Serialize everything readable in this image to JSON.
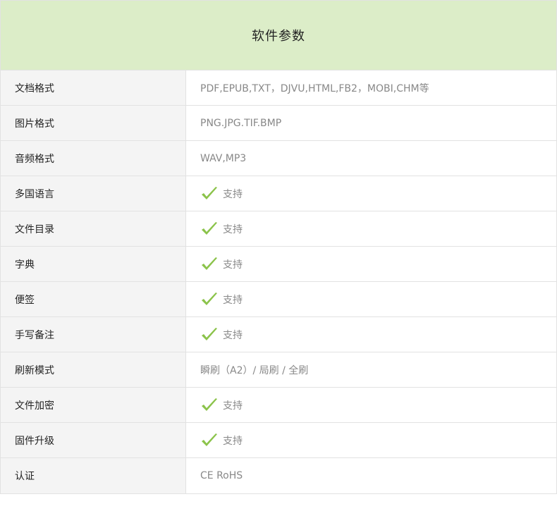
{
  "header": {
    "title": "软件参数"
  },
  "colors": {
    "header_bg": "#dcedc8",
    "check_green": "#8bc34a"
  },
  "rows": [
    {
      "label": "文档格式",
      "value": "PDF,EPUB,TXT，DJVU,HTML,FB2，MOBI,CHM等",
      "check": false
    },
    {
      "label": "图片格式",
      "value": "PNG.JPG.TIF.BMP",
      "check": false
    },
    {
      "label": "音频格式",
      "value": "WAV,MP3",
      "check": false
    },
    {
      "label": "多国语言",
      "value": "支持",
      "check": true,
      "icon": "check-icon"
    },
    {
      "label": "文件目录",
      "value": "支持",
      "check": true,
      "icon": "check-icon"
    },
    {
      "label": "字典",
      "value": "支持",
      "check": true,
      "icon": "check-icon"
    },
    {
      "label": "便签",
      "value": "支持",
      "check": true,
      "icon": "check-icon"
    },
    {
      "label": "手写备注",
      "value": "支持",
      "check": true,
      "icon": "check-icon"
    },
    {
      "label": "刷新模式",
      "value": "瞬刷（A2）/ 局刷 / 全刷",
      "check": false
    },
    {
      "label": "文件加密",
      "value": "支持",
      "check": true,
      "icon": "check-icon"
    },
    {
      "label": "固件升级",
      "value": "支持",
      "check": true,
      "icon": "check-icon"
    },
    {
      "label": "认证",
      "value": "CE RoHS",
      "check": false
    }
  ]
}
